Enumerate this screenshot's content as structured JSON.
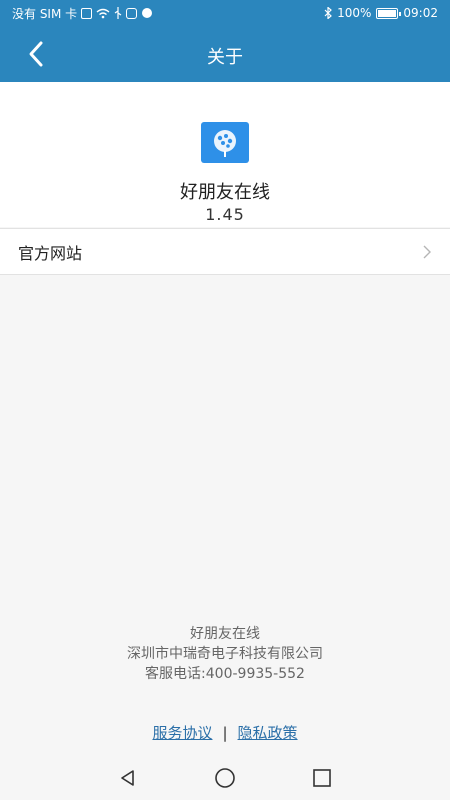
{
  "status_bar": {
    "carrier": "没有 SIM 卡",
    "battery": "100%",
    "time": "09:02"
  },
  "app_bar": {
    "title": "关于"
  },
  "app_info": {
    "name": "好朋友在线",
    "version": "1.45"
  },
  "menu": {
    "official_site": "官方网站"
  },
  "footer": {
    "app_name": "好朋友在线",
    "company": "深圳市中瑞奇电子科技有限公司",
    "hotline": "客服电话:400-9935-552"
  },
  "links": {
    "service_agreement": "服务协议",
    "separator": "|",
    "privacy_policy": "隐私政策"
  },
  "colors": {
    "primary": "#2b86bd",
    "icon_bg": "#2e90e8",
    "link": "#2b6fa8"
  }
}
